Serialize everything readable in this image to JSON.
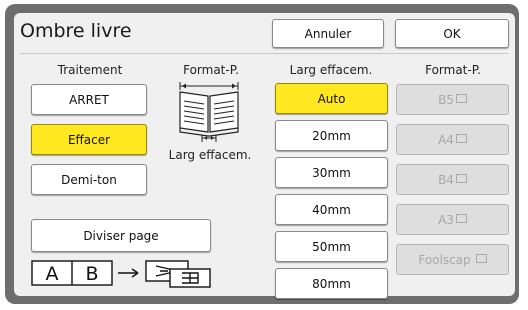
{
  "title": "Ombre livre",
  "header": {
    "cancel_label": "Annuler",
    "ok_label": "OK"
  },
  "columns": {
    "traitement": "Traitement",
    "format_p_left": "Format-P.",
    "larg_effacem": "Larg effacem.",
    "format_p_right": "Format-P."
  },
  "traitement_options": [
    "ARRET",
    "Effacer",
    "Demi-ton"
  ],
  "traitement_selected": "Effacer",
  "diagram_label": "Larg effacem.",
  "width_options": [
    "Auto",
    "20mm",
    "30mm",
    "40mm",
    "50mm",
    "80mm"
  ],
  "width_selected": "Auto",
  "format_options": [
    "B5",
    "A4",
    "B4",
    "A3",
    "Foolscap"
  ],
  "diviser_label": "Diviser page",
  "diagram_letters": {
    "a": "A",
    "b": "B"
  },
  "colors": {
    "selected": "#ffe81f",
    "frame": "#6e6e6e",
    "panel": "#f0f0f0"
  }
}
